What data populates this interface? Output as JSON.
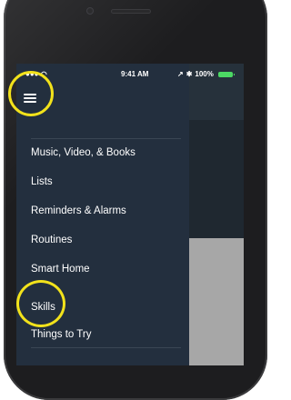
{
  "status_bar": {
    "signal": "●●● ◠",
    "time": "9:41 AM",
    "location_icon": "↗",
    "bluetooth_icon": "✱",
    "battery_percent": "100%",
    "battery_level": 1.0
  },
  "drawer": {
    "menu_icon": "hamburger-menu-icon",
    "items": [
      {
        "label": "Music, Video, & Books"
      },
      {
        "label": "Lists"
      },
      {
        "label": "Reminders & Alarms"
      },
      {
        "label": "Routines"
      },
      {
        "label": "Smart Home"
      },
      {
        "label": "Skills"
      },
      {
        "label": "Things to Try"
      }
    ]
  },
  "colors": {
    "drawer_background": "#232f3e",
    "highlight_ring": "#f2e21b",
    "battery": "#4cd964"
  }
}
